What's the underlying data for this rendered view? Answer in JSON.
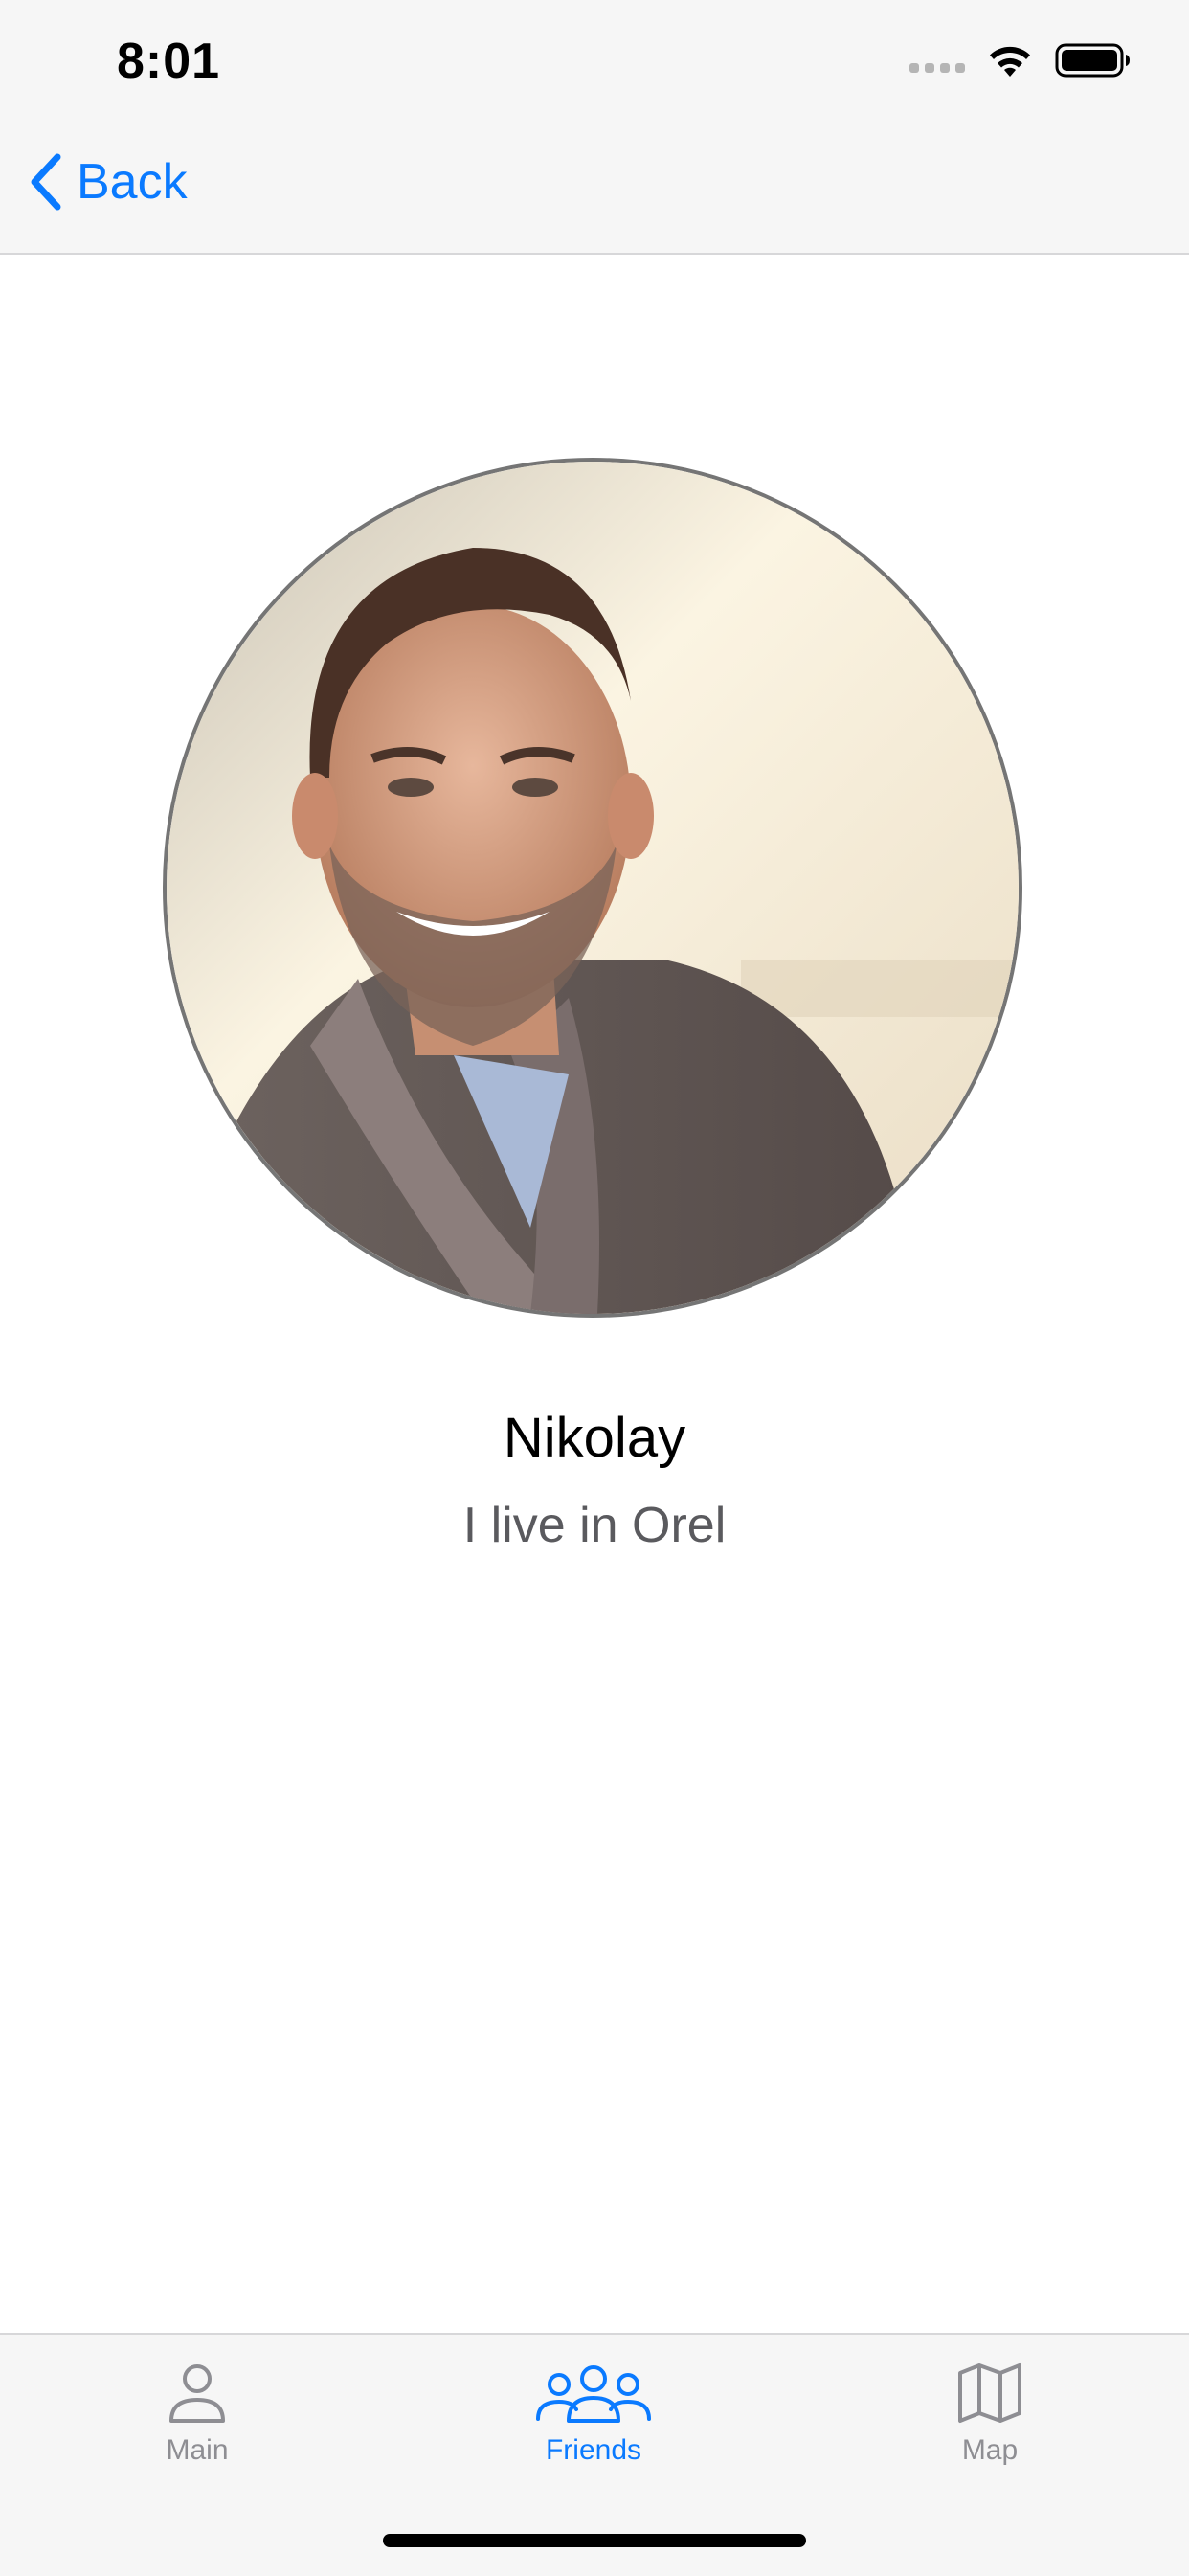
{
  "status_bar": {
    "time": "8:01",
    "icons": [
      "signal-dots-icon",
      "wifi-icon",
      "battery-icon"
    ]
  },
  "nav": {
    "back_label": "Back",
    "back_icon": "chevron-left-icon"
  },
  "profile": {
    "name": "Nikolay",
    "status": "I live in Orel",
    "avatar_description": "person-photo"
  },
  "tab_bar": {
    "tabs": [
      {
        "label": "Main",
        "icon": "person-icon",
        "selected": false
      },
      {
        "label": "Friends",
        "icon": "people-group-icon",
        "selected": true
      },
      {
        "label": "Map",
        "icon": "map-icon",
        "selected": false
      }
    ]
  },
  "colors": {
    "accent": "#0a7aff",
    "inactive": "#8e8e93",
    "bar_background": "#f6f6f6"
  }
}
